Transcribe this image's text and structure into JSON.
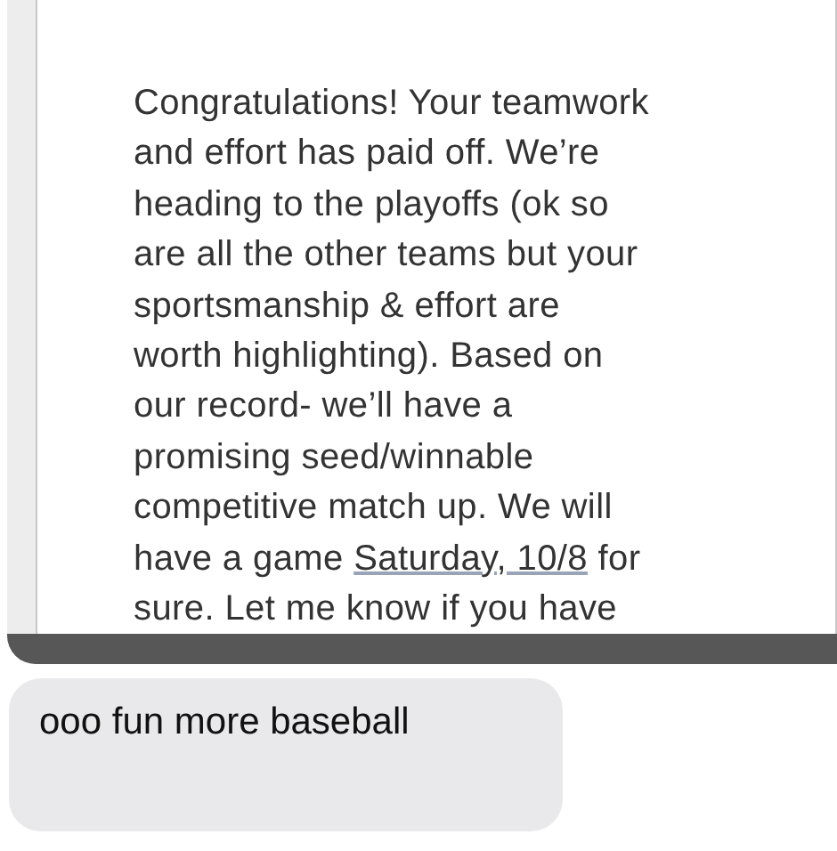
{
  "shared_message": {
    "lines": [
      [
        {
          "kind": "text",
          "text": "Congratulations! Your teamwork"
        }
      ],
      [
        {
          "kind": "text",
          "text": "and effort has paid off. We’re"
        }
      ],
      [
        {
          "kind": "text",
          "text": "heading to the playoffs (ok so"
        }
      ],
      [
        {
          "kind": "text",
          "text": "are all the other teams but your"
        }
      ],
      [
        {
          "kind": "text",
          "text": "sportsmanship & effort are"
        }
      ],
      [
        {
          "kind": "text",
          "text": "worth highlighting). Based on"
        }
      ],
      [
        {
          "kind": "text",
          "text": "our record- we’ll have a"
        }
      ],
      [
        {
          "kind": "text",
          "text": "promising seed/winnable"
        }
      ],
      [
        {
          "kind": "text",
          "text": "competitive match up. We will"
        }
      ],
      [
        {
          "kind": "text",
          "text": "have a game "
        },
        {
          "kind": "link",
          "text": "Saturday, 10/8"
        },
        {
          "kind": "text",
          "text": " for"
        }
      ],
      [
        {
          "kind": "text",
          "text": "sure. Let me know if you have"
        }
      ]
    ]
  },
  "reply": {
    "text": "ooo fun more baseball"
  }
}
